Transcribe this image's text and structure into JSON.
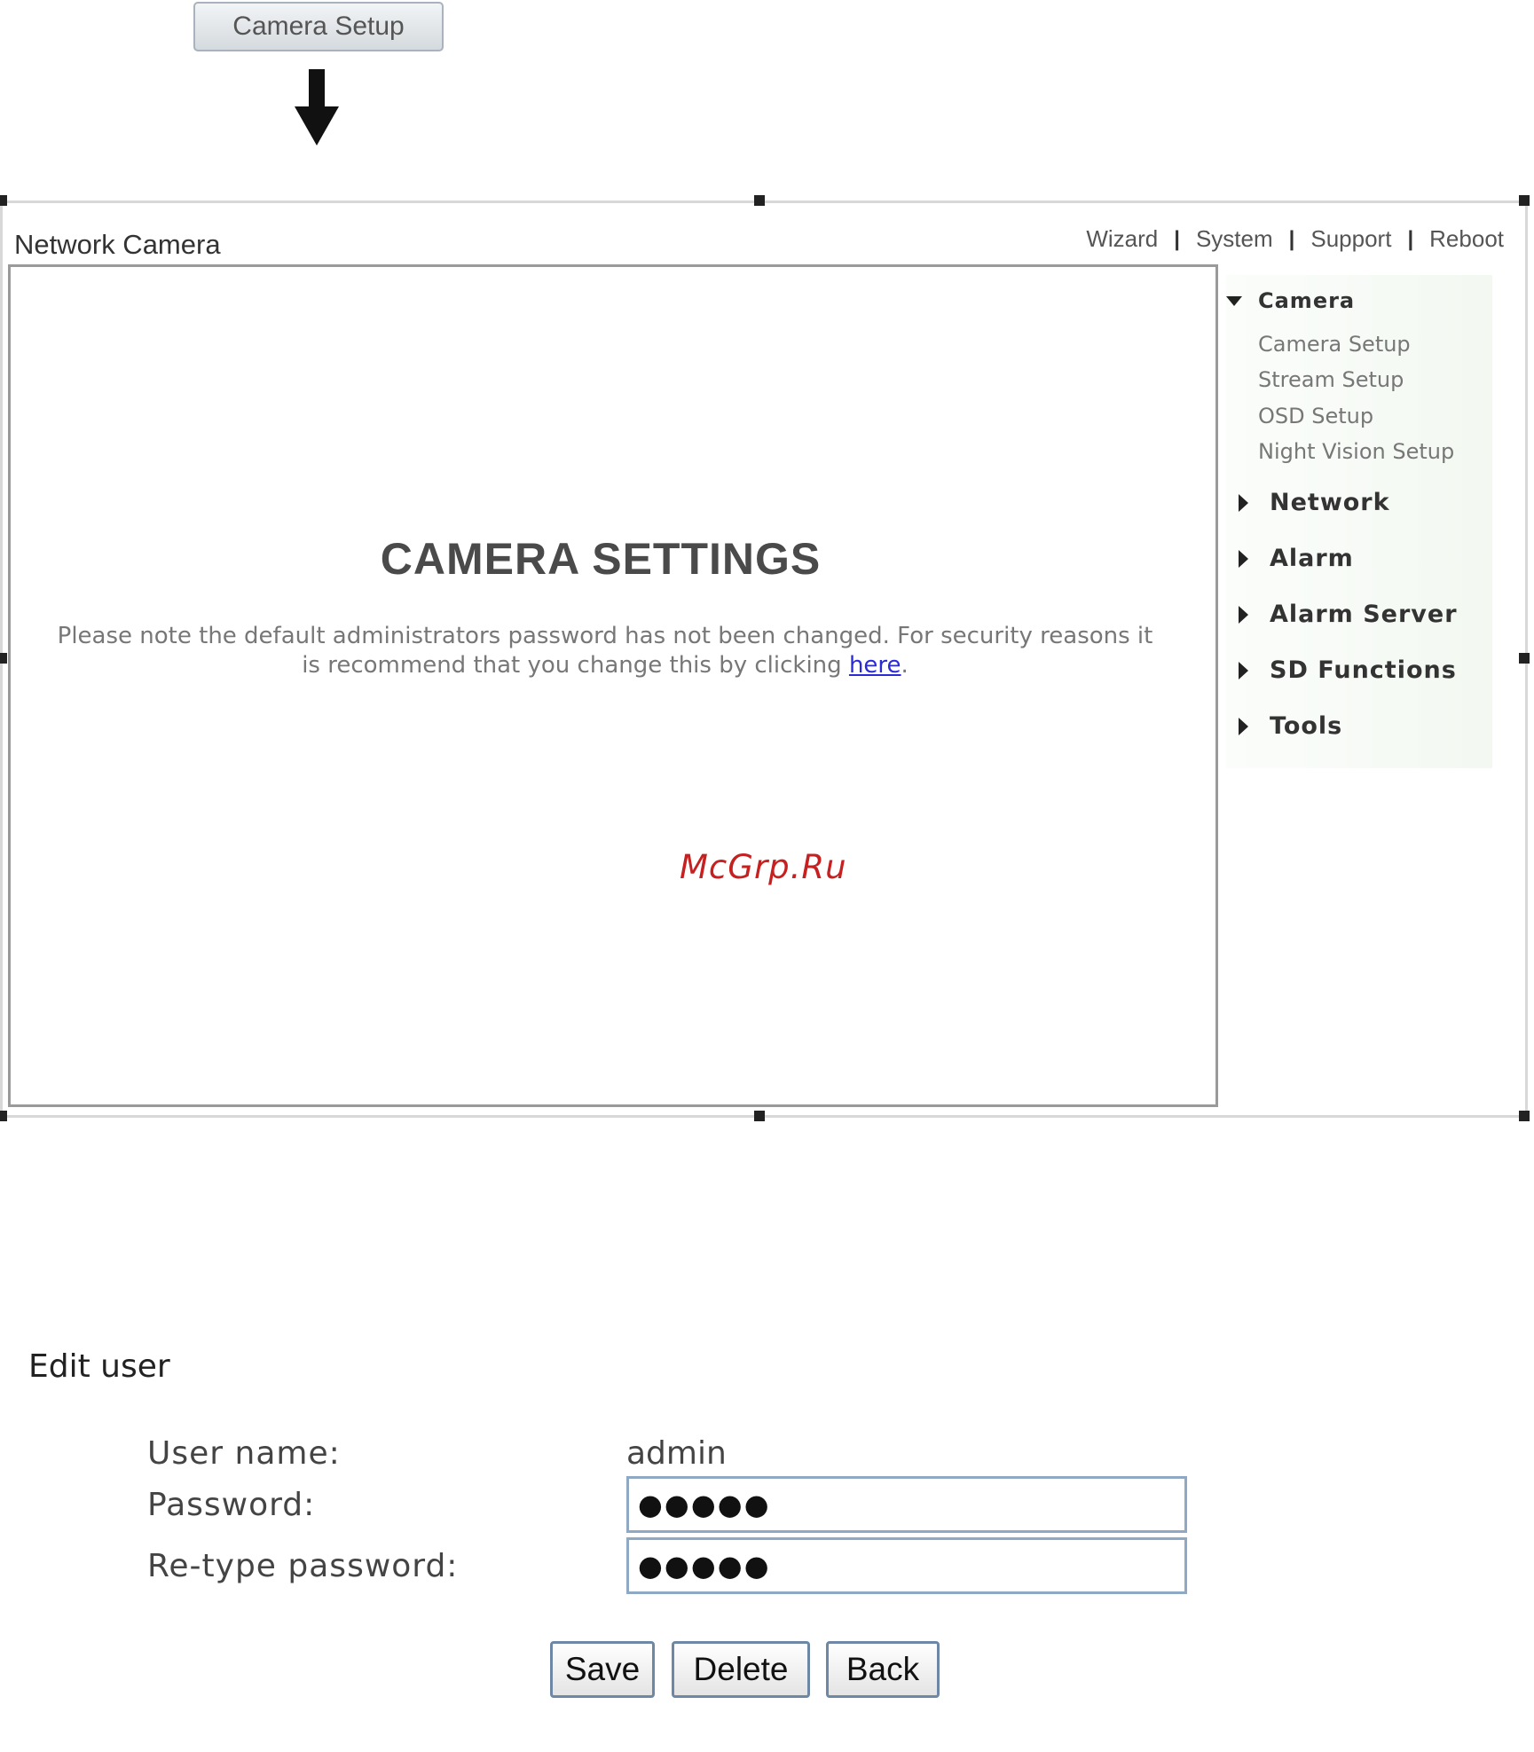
{
  "top_button": {
    "label": "Camera Setup"
  },
  "header": {
    "app_title": "Network Camera",
    "nav": [
      {
        "label": "Wizard"
      },
      {
        "label": "System"
      },
      {
        "label": "Support"
      },
      {
        "label": "Reboot"
      }
    ],
    "separator": "|"
  },
  "main": {
    "title": "CAMERA SETTINGS",
    "notice_before": "Please note the default administrators password has not been changed. For security reasons it is recommend that you change this by clicking ",
    "notice_link": "here",
    "notice_after": "."
  },
  "watermark": "McGrp.Ru",
  "sidebar": {
    "camera": {
      "label": "Camera",
      "items": [
        {
          "label": "Camera Setup"
        },
        {
          "label": "Stream Setup"
        },
        {
          "label": "OSD Setup"
        },
        {
          "label": "Night Vision Setup"
        }
      ]
    },
    "sections": [
      {
        "label": "Network"
      },
      {
        "label": "Alarm"
      },
      {
        "label": "Alarm Server"
      },
      {
        "label": "SD Functions"
      },
      {
        "label": "Tools"
      }
    ]
  },
  "edit_user": {
    "title": "Edit user",
    "username_label": "User name:",
    "username_value": "admin",
    "password_label": "Password:",
    "password_value": "●●●●●",
    "retype_label": "Re-type password:",
    "retype_value": "●●●●●",
    "buttons": {
      "save": "Save",
      "delete": "Delete",
      "back": "Back"
    }
  }
}
